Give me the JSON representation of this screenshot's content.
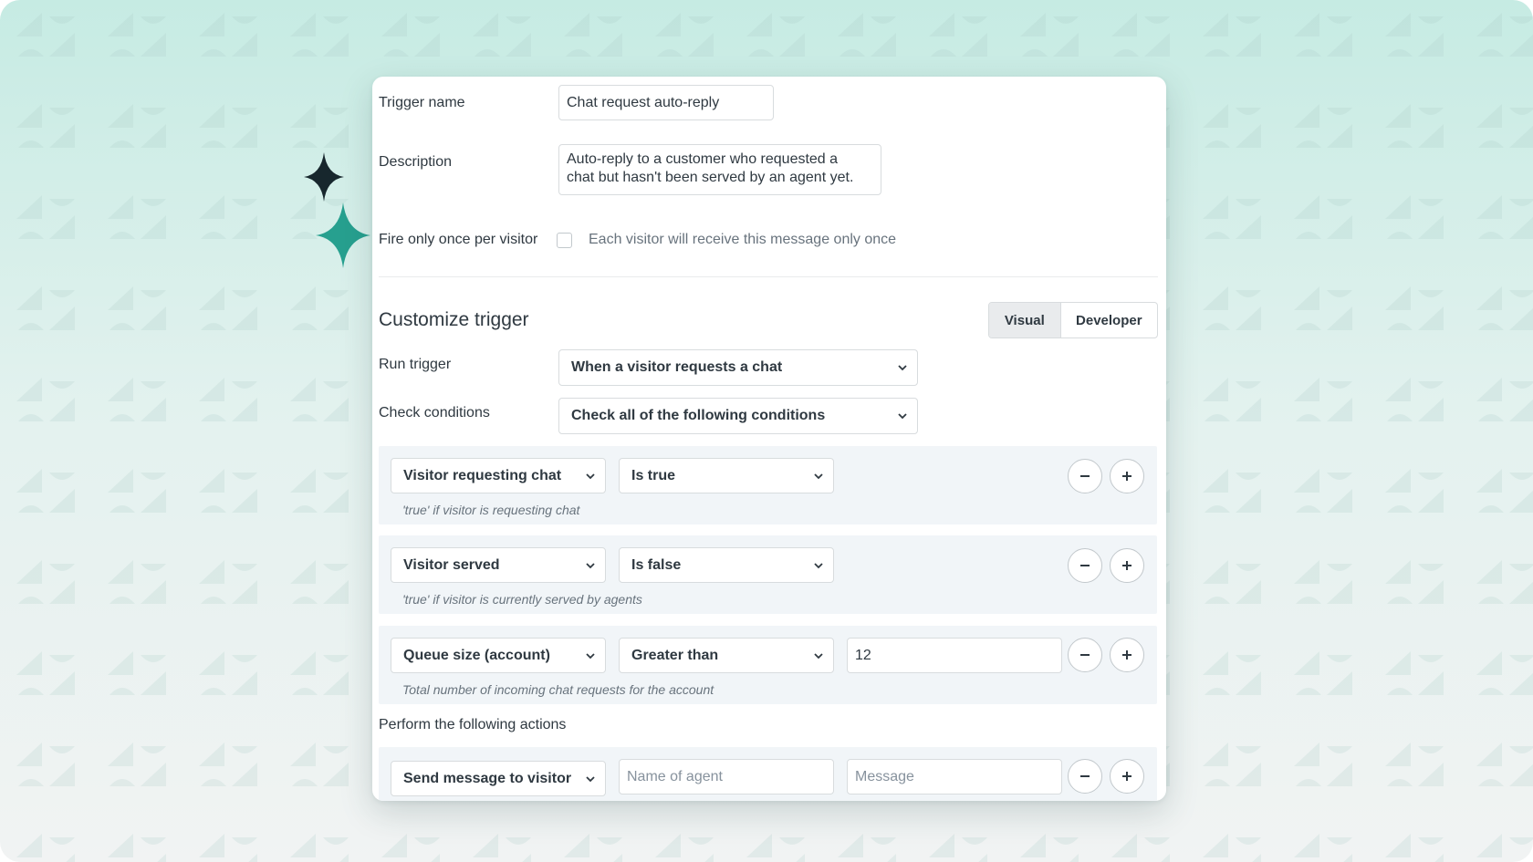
{
  "form": {
    "trigger_name_label": "Trigger name",
    "trigger_name_value": "Chat request auto-reply",
    "description_label": "Description",
    "description_line1": "Auto-reply to a customer who requested a",
    "description_line2": "chat but hasn't been served by an agent yet.",
    "fire_once_label": "Fire only once per visitor",
    "fire_once_checked": false,
    "fire_once_hint": "Each visitor will receive this message only once"
  },
  "customize": {
    "title": "Customize trigger",
    "modes": [
      "Visual",
      "Developer"
    ],
    "active_mode": "Visual",
    "run_trigger_label": "Run trigger",
    "run_trigger_value": "When a visitor requests a chat",
    "check_conditions_label": "Check conditions",
    "check_conditions_value": "Check all of the following conditions"
  },
  "conditions": [
    {
      "field": "Visitor requesting chat",
      "operator": "Is true",
      "hint": "'true' if visitor is requesting chat"
    },
    {
      "field": "Visitor served",
      "operator": "Is false",
      "hint": "'true' if visitor is currently served by agents"
    },
    {
      "field": "Queue size (account)",
      "operator": "Greater than",
      "value": "12",
      "hint": "Total number of incoming chat requests for the account"
    }
  ],
  "actions": {
    "label": "Perform the following actions",
    "items": [
      {
        "action": "Send message to visitor",
        "agent_placeholder": "Name of agent",
        "message_placeholder": "Message"
      }
    ]
  },
  "colors": {
    "background_top": "#c6ebe3",
    "sparkle_dark": "#17272d",
    "sparkle_teal": "#27a08f"
  }
}
